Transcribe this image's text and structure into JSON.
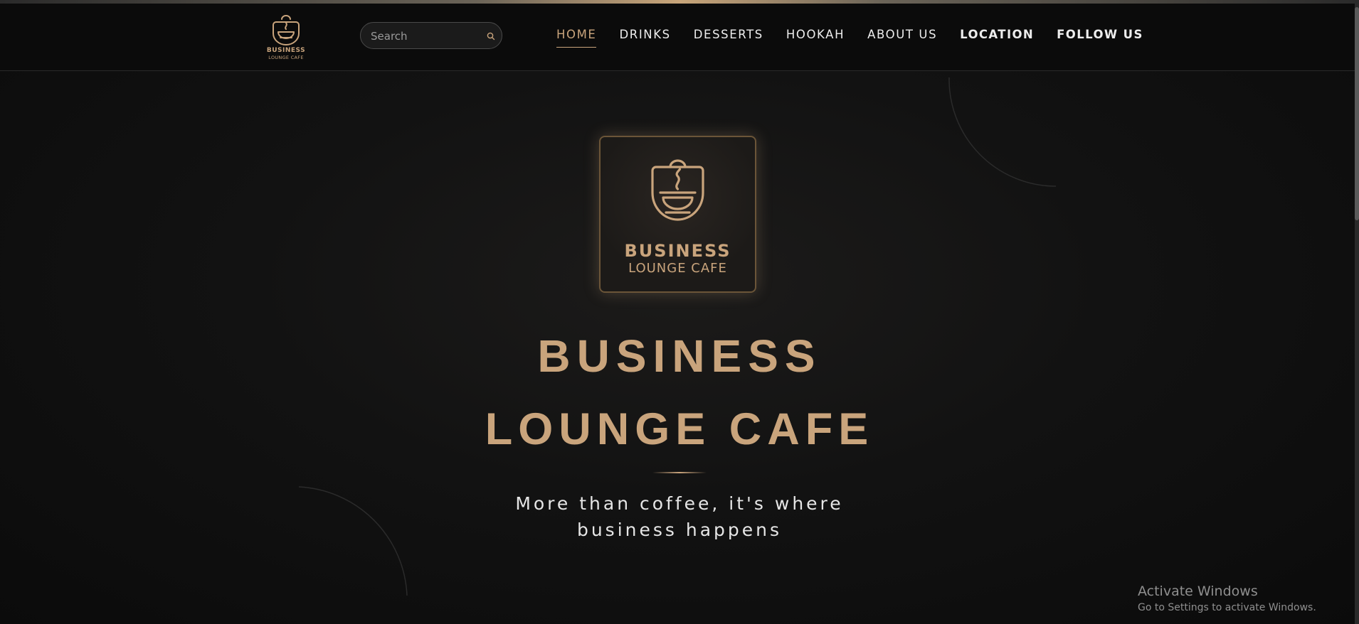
{
  "header": {
    "brand_line1": "BUSINESS",
    "brand_line2": "LOUNGE CAFE",
    "search": {
      "placeholder": "Search",
      "icon": "search-icon"
    },
    "nav": [
      {
        "label": "HOME",
        "active": true
      },
      {
        "label": "DRINKS",
        "active": false
      },
      {
        "label": "DESSERTS",
        "active": false
      },
      {
        "label": "HOOKAH",
        "active": false
      },
      {
        "label": "ABOUT US",
        "active": false
      },
      {
        "label": "LOCATION",
        "active": false
      },
      {
        "label": "FOLLOW US",
        "active": false
      }
    ]
  },
  "hero": {
    "logo_brand1": "BUSINESS",
    "logo_brand2": "LOUNGE CAFE",
    "title_line1": "BUSINESS",
    "title_line2": "LOUNGE CAFE",
    "tagline": "More than coffee, it's where business happens"
  },
  "os_overlay": {
    "activate_title": "Activate Windows",
    "activate_sub": "Go to Settings to activate Windows."
  },
  "colors": {
    "accent_gold": "#c9a47c",
    "background": "#121212",
    "header_bg": "#0b0b0b",
    "nav_text": "#ededed"
  }
}
